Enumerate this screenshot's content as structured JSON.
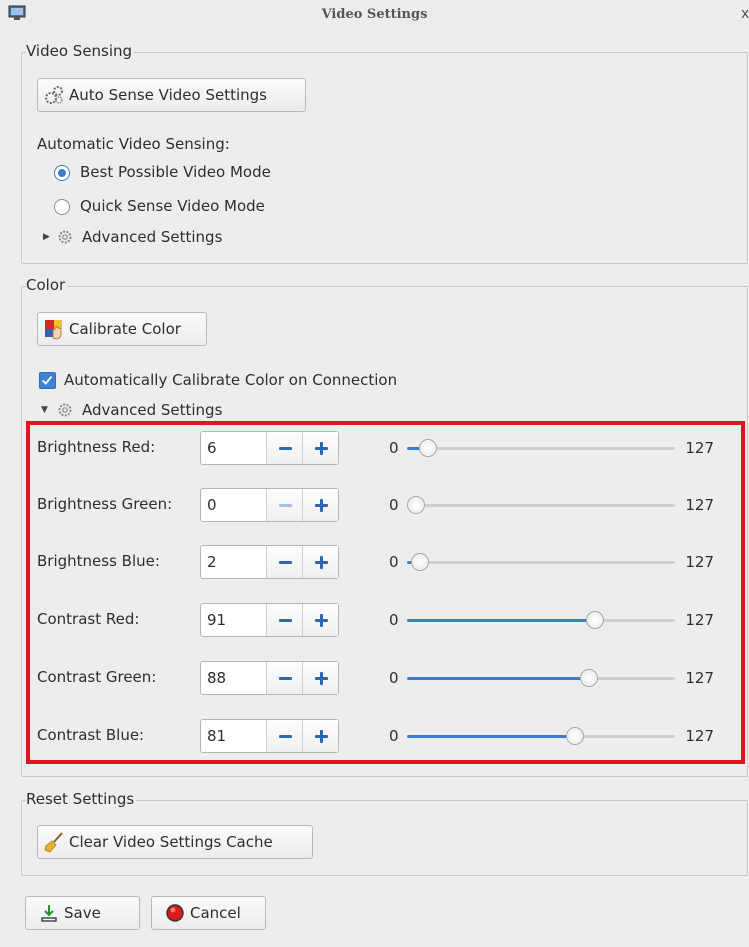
{
  "window": {
    "title": "Video Settings",
    "close_glyph": "x",
    "app_icon": "monitor-icon"
  },
  "video_sensing": {
    "legend": "Video Sensing",
    "auto_sense_button": "Auto Sense Video Settings",
    "auto_sense_icon": "gears-icon",
    "automatic_label": "Automatic Video Sensing:",
    "radio_best": "Best Possible Video Mode",
    "radio_quick": "Quick Sense Video Mode",
    "selected_mode": "Best Possible Video Mode",
    "advanced_label": "Advanced Settings",
    "advanced_expanded": false
  },
  "color": {
    "legend": "Color",
    "calibrate_button": "Calibrate Color",
    "calibrate_icon": "color-palette-hand-icon",
    "auto_calibrate_label": "Automatically Calibrate Color on Connection",
    "auto_calibrate_checked": true,
    "advanced_label": "Advanced Settings",
    "advanced_expanded": true,
    "slider_min_label": "0",
    "slider_max_label": "127",
    "slider_max": 127,
    "rows": [
      {
        "label": "Brightness Red:",
        "value": "6",
        "level": 6,
        "minus_enabled": true
      },
      {
        "label": "Brightness Green:",
        "value": "0",
        "level": 0,
        "minus_enabled": false
      },
      {
        "label": "Brightness Blue:",
        "value": "2",
        "level": 2,
        "minus_enabled": true
      },
      {
        "label": "Contrast Red:",
        "value": "91",
        "level": 91,
        "minus_enabled": true
      },
      {
        "label": "Contrast Green:",
        "value": "88",
        "level": 88,
        "minus_enabled": true
      },
      {
        "label": "Contrast Blue:",
        "value": "81",
        "level": 81,
        "minus_enabled": true
      }
    ]
  },
  "reset": {
    "legend": "Reset Settings",
    "clear_button": "Clear Video Settings Cache",
    "clear_icon": "broom-icon"
  },
  "footer": {
    "save_button": "Save",
    "save_icon": "save-download-icon",
    "cancel_button": "Cancel",
    "cancel_icon": "red-stop-icon"
  },
  "colors": {
    "accent": "#3c7ccc",
    "highlight": "#e3141f",
    "background": "#ededed"
  }
}
